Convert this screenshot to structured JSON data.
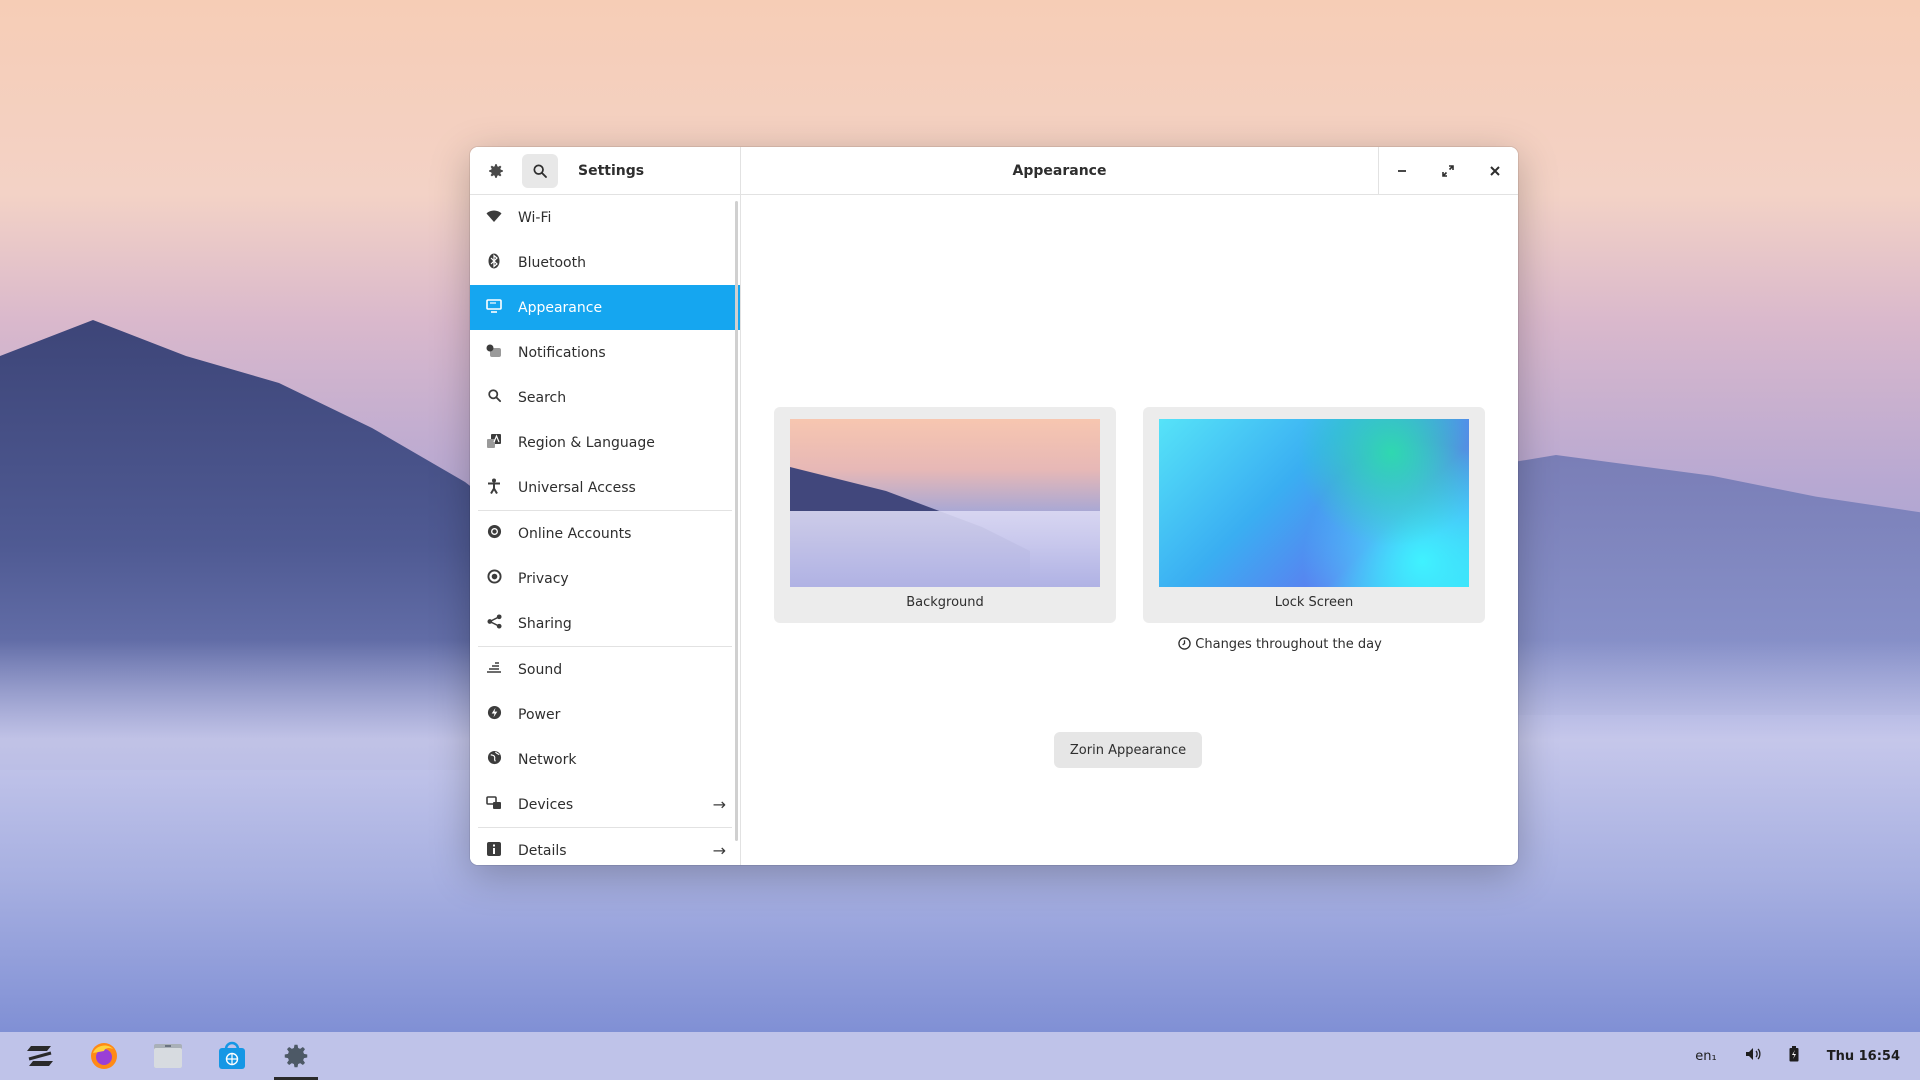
{
  "window": {
    "sidebar_title": "Settings",
    "main_title": "Appearance"
  },
  "sidebar": {
    "items": [
      {
        "label": "Wi-Fi",
        "icon": "wifi-icon"
      },
      {
        "label": "Bluetooth",
        "icon": "bluetooth-icon"
      },
      {
        "label": "Appearance",
        "icon": "display-icon"
      },
      {
        "label": "Notifications",
        "icon": "notifications-icon"
      },
      {
        "label": "Search",
        "icon": "search-icon"
      },
      {
        "label": "Region & Language",
        "icon": "region-icon"
      },
      {
        "label": "Universal Access",
        "icon": "accessibility-icon"
      },
      {
        "label": "Online Accounts",
        "icon": "online-accounts-icon"
      },
      {
        "label": "Privacy",
        "icon": "privacy-icon"
      },
      {
        "label": "Sharing",
        "icon": "share-icon"
      },
      {
        "label": "Sound",
        "icon": "sound-icon"
      },
      {
        "label": "Power",
        "icon": "power-icon"
      },
      {
        "label": "Network",
        "icon": "network-icon"
      },
      {
        "label": "Devices",
        "icon": "devices-icon"
      },
      {
        "label": "Details",
        "icon": "info-icon"
      }
    ],
    "active": "Appearance"
  },
  "content": {
    "background_label": "Background",
    "lockscreen_label": "Lock Screen",
    "changes_text": "Changes throughout the day",
    "zorin_button": "Zorin Appearance"
  },
  "taskbar": {
    "keyboard_layout": "en₁",
    "clock": "Thu 16:54"
  },
  "colors": {
    "accent": "#15a6f0"
  }
}
